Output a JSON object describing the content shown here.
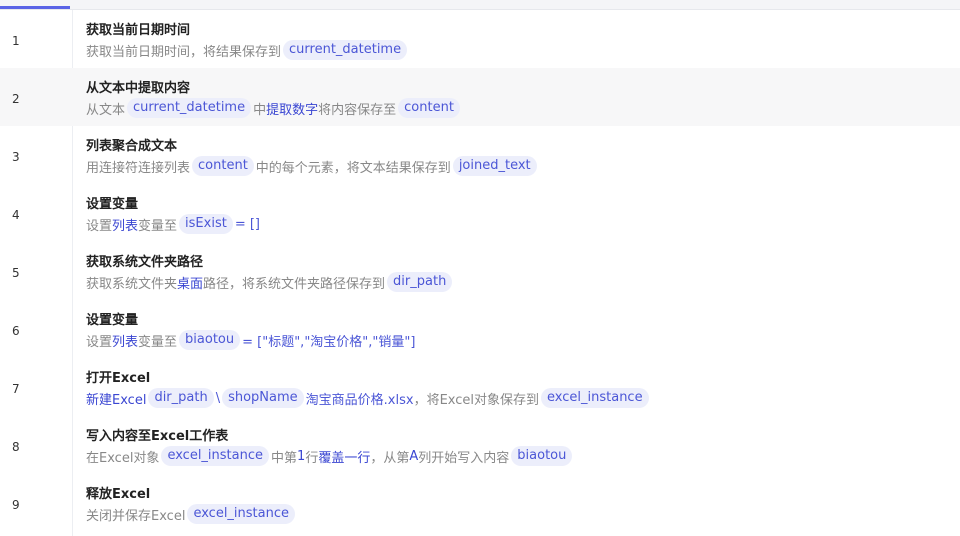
{
  "steps": [
    {
      "num": "1",
      "title": "获取当前日期时间",
      "desc": [
        {
          "t": "txt",
          "v": "获取当前日期时间，将结果保存到"
        },
        {
          "t": "var",
          "v": "current_datetime"
        }
      ]
    },
    {
      "num": "2",
      "title": "从文本中提取内容",
      "desc": [
        {
          "t": "txt",
          "v": "从文本"
        },
        {
          "t": "var",
          "v": "current_datetime"
        },
        {
          "t": "txt",
          "v": "中"
        },
        {
          "t": "kw",
          "v": "提取数字"
        },
        {
          "t": "txt",
          "v": "将内容保存至"
        },
        {
          "t": "var",
          "v": "content"
        }
      ]
    },
    {
      "num": "3",
      "title": "列表聚合成文本",
      "desc": [
        {
          "t": "txt",
          "v": "用连接符连接列表"
        },
        {
          "t": "var",
          "v": "content"
        },
        {
          "t": "txt",
          "v": "中的每个元素，将文本结果保存到"
        },
        {
          "t": "var",
          "v": "joined_text"
        }
      ]
    },
    {
      "num": "4",
      "title": "设置变量",
      "desc": [
        {
          "t": "txt",
          "v": "设置"
        },
        {
          "t": "kw",
          "v": "列表"
        },
        {
          "t": "txt",
          "v": "变量至"
        },
        {
          "t": "var",
          "v": "isExist"
        },
        {
          "t": "lit",
          "v": "= []"
        }
      ]
    },
    {
      "num": "5",
      "title": "获取系统文件夹路径",
      "desc": [
        {
          "t": "txt",
          "v": "获取系统文件夹"
        },
        {
          "t": "kw",
          "v": "桌面"
        },
        {
          "t": "txt",
          "v": "路径，将系统文件夹路径保存到"
        },
        {
          "t": "var",
          "v": "dir_path"
        }
      ]
    },
    {
      "num": "6",
      "title": "设置变量",
      "desc": [
        {
          "t": "txt",
          "v": "设置"
        },
        {
          "t": "kw",
          "v": "列表"
        },
        {
          "t": "txt",
          "v": "变量至"
        },
        {
          "t": "var",
          "v": "biaotou"
        },
        {
          "t": "lit",
          "v": "= [\"标题\",\"淘宝价格\",\"销量\"]"
        }
      ]
    },
    {
      "num": "7",
      "title": "打开Excel",
      "desc": [
        {
          "t": "kw",
          "v": "新建Excel"
        },
        {
          "t": "var",
          "v": "dir_path"
        },
        {
          "t": "lit",
          "v": "\\"
        },
        {
          "t": "var",
          "v": "shopName"
        },
        {
          "t": "lit",
          "v": "淘宝商品价格.xlsx"
        },
        {
          "t": "txt",
          "v": "，将Excel对象保存到"
        },
        {
          "t": "var",
          "v": "excel_instance"
        }
      ]
    },
    {
      "num": "8",
      "title": "写入内容至Excel工作表",
      "desc": [
        {
          "t": "txt",
          "v": "在Excel对象"
        },
        {
          "t": "var",
          "v": "excel_instance"
        },
        {
          "t": "txt",
          "v": "中第"
        },
        {
          "t": "kw",
          "v": "1"
        },
        {
          "t": "txt",
          "v": "行"
        },
        {
          "t": "kw",
          "v": "覆盖一行"
        },
        {
          "t": "txt",
          "v": "，从第"
        },
        {
          "t": "kw",
          "v": "A"
        },
        {
          "t": "txt",
          "v": "列开始写入内容"
        },
        {
          "t": "var",
          "v": "biaotou"
        }
      ]
    },
    {
      "num": "9",
      "title": "释放Excel",
      "desc": [
        {
          "t": "txt",
          "v": "关闭并保存Excel"
        },
        {
          "t": "var",
          "v": "excel_instance"
        }
      ]
    }
  ],
  "highlighted_step": "2",
  "colors": {
    "accent": "#5a64e6",
    "variable_bg": "#eceefb",
    "variable_text": "#4b56d6",
    "keyword": "#3a46d2",
    "muted_text": "#888888",
    "highlight_row": "#f7f7f8"
  }
}
